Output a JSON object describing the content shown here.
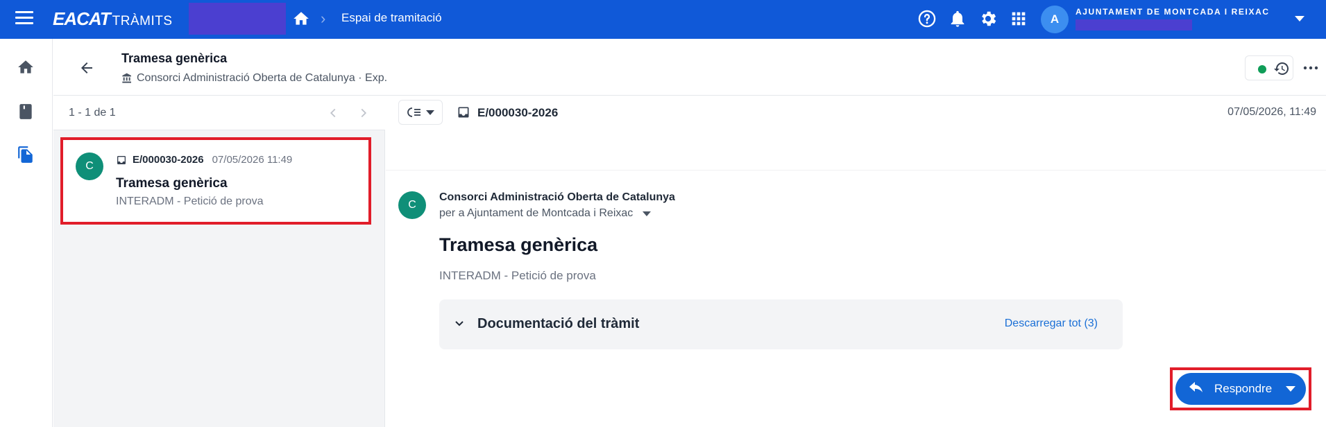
{
  "topbar": {
    "brand_main": "EACAT",
    "brand_sub": "TRÀMITS",
    "breadcrumb": "Espai de tramitació",
    "avatar_initial": "A",
    "org_name": "AJUNTAMENT DE MONTCADA I REIXAC",
    "icons": [
      "help-icon",
      "bell-icon",
      "gear-icon",
      "apps-grid-icon"
    ]
  },
  "rail": {
    "icons": [
      "home-icon",
      "book-icon",
      "documents-icon"
    ]
  },
  "header": {
    "title": "Tramesa genèrica",
    "subtitle": "Consorci Administració Oberta de Catalunya · Exp."
  },
  "list": {
    "pager": "1 - 1 de 1",
    "items": [
      {
        "avatar": "C",
        "code": "E/000030-2026",
        "date": "07/05/2026 11:49",
        "title": "Tramesa genèrica",
        "description": "INTERADM - Petició de prova"
      }
    ]
  },
  "detail": {
    "code": "E/000030-2026",
    "date": "07/05/2026, 11:49",
    "sender_avatar": "C",
    "sender": "Consorci Administració Oberta de Catalunya",
    "recipient": "per a Ajuntament de Montcada i Reixac",
    "title": "Tramesa genèrica",
    "description": "INTERADM - Petició de prova",
    "documents_title": "Documentació del tràmit",
    "download_all": "Descarregar tot (3)",
    "reply_label": "Respondre"
  },
  "colors": {
    "topbar": "#1059d8",
    "accent": "#1266d6",
    "avatar_teal": "#0f8f78",
    "highlight": "#e11d2a",
    "status_green": "#0f9d58"
  }
}
